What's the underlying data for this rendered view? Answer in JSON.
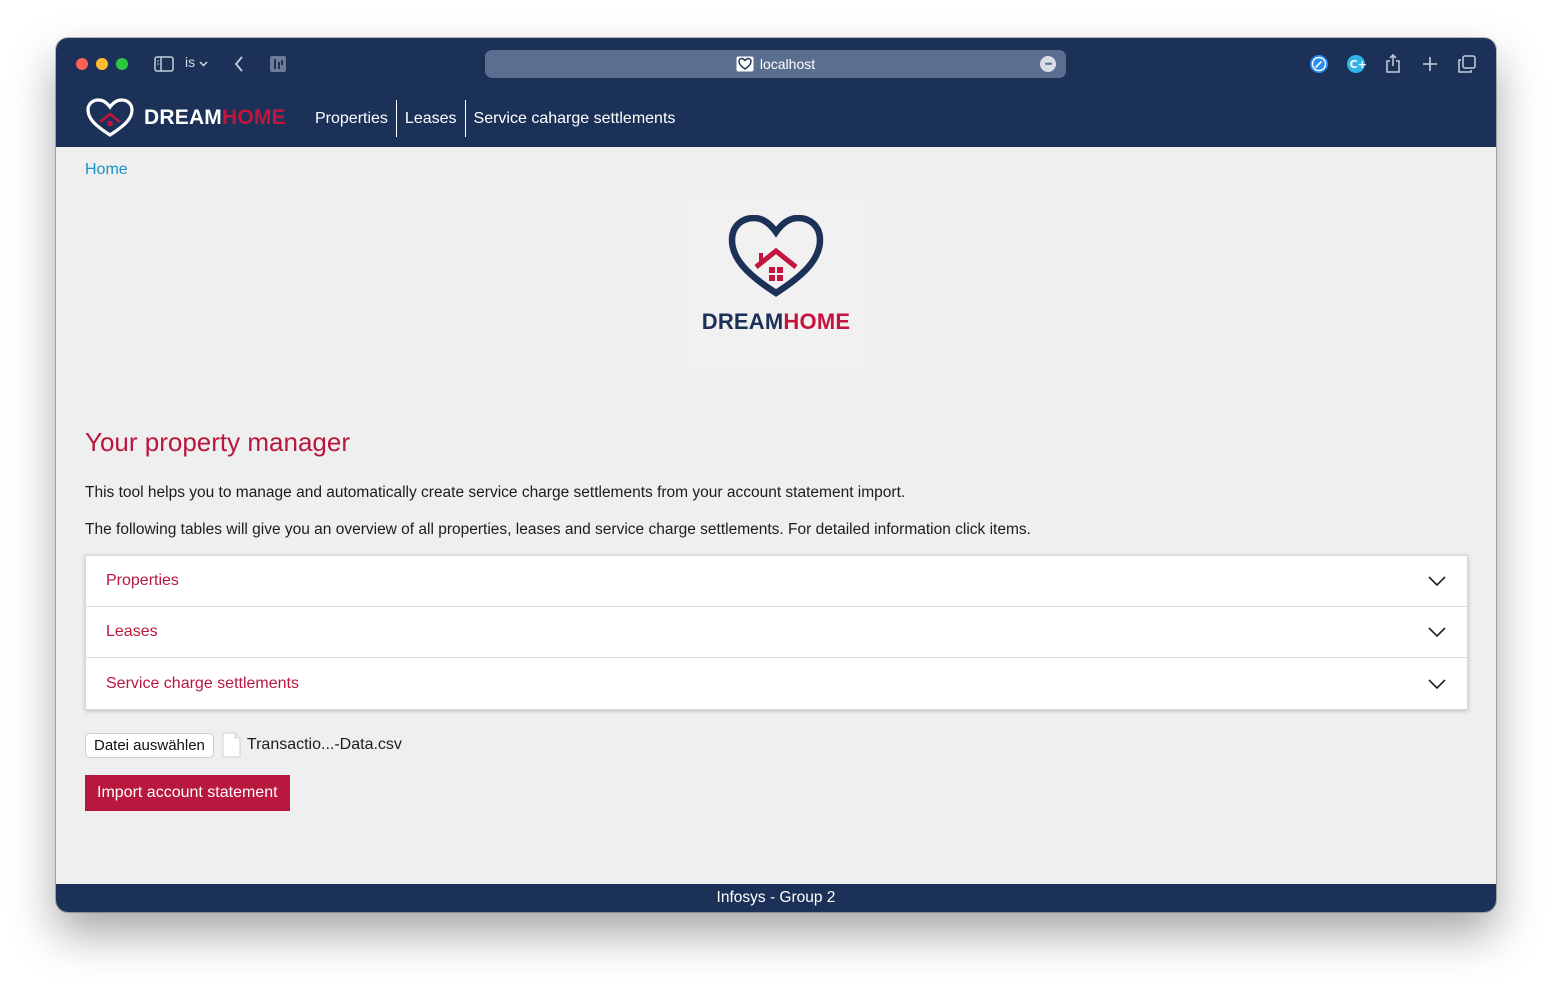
{
  "browser": {
    "profile_label": "is",
    "url": "localhost",
    "accent_color": "#1b3157"
  },
  "nav": {
    "brand_dream": "DREAM",
    "brand_home": "HOME",
    "links": [
      "Properties",
      "Leases",
      "Service caharge settlements"
    ]
  },
  "breadcrumb": "Home",
  "logo": {
    "dream": "DREAM",
    "home": "HOME"
  },
  "main": {
    "title": "Your property manager",
    "intro_1": "This tool helps you to manage and automatically create service charge settlements from your account statement import.",
    "intro_2": "The following tables will give you an overview of all properties, leases and service charge settlements. For detailed information click items."
  },
  "accordion": {
    "items": [
      "Properties",
      "Leases",
      "Service charge settlements"
    ]
  },
  "upload": {
    "choose_file_label": "Datei auswählen",
    "file_name": "Transactio...-Data.csv",
    "import_label": "Import account statement"
  },
  "footer": "Infosys - Group 2",
  "colors": {
    "navy": "#1b3157",
    "brand_red": "#b8173e",
    "link_blue": "#1a92c9",
    "page_bg": "#efefef"
  }
}
